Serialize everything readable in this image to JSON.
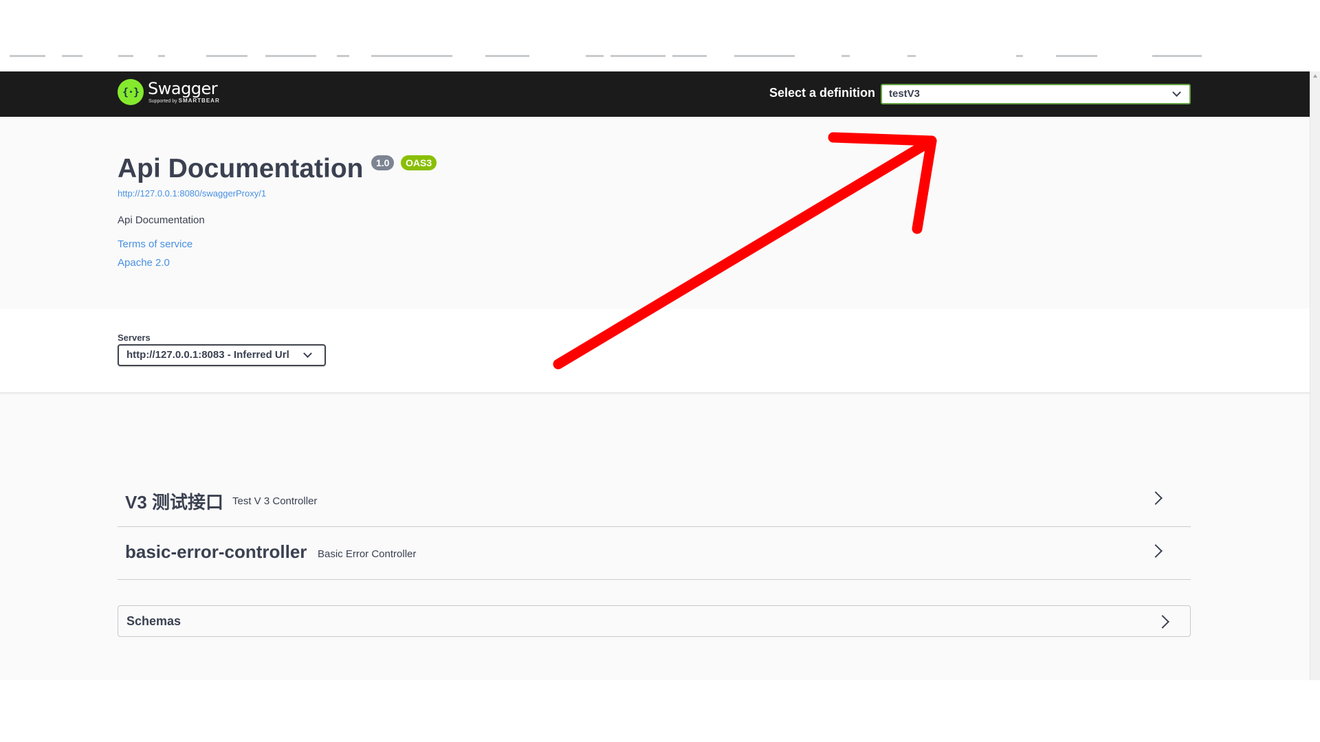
{
  "topbar": {
    "logo_title": "Swagger",
    "logo_sub_prefix": "Supported by",
    "logo_sub_brand": "SMARTBEAR",
    "logo_icon": "swagger-braces-icon",
    "definition_label": "Select a definition",
    "definition_value": "testV3"
  },
  "info": {
    "title": "Api Documentation",
    "version_badge": "1.0",
    "oas_badge": "OAS3",
    "base_url": "http://127.0.0.1:8080/swaggerProxy/1",
    "description": "Api Documentation",
    "terms_link": "Terms of service",
    "license_link": "Apache 2.0"
  },
  "servers": {
    "label": "Servers",
    "selected": "http://127.0.0.1:8083 - Inferred Url"
  },
  "tags": [
    {
      "name": "V3 测试接口",
      "description": "Test V 3 Controller"
    },
    {
      "name": "basic-error-controller",
      "description": "Basic Error Controller"
    }
  ],
  "schemas": {
    "title": "Schemas"
  },
  "colors": {
    "topbar_bg": "#1b1b1b",
    "accent_green": "#89bf04",
    "logo_green": "#85ea2d",
    "link_blue": "#4990e2",
    "annotation_red": "#ff0000"
  }
}
